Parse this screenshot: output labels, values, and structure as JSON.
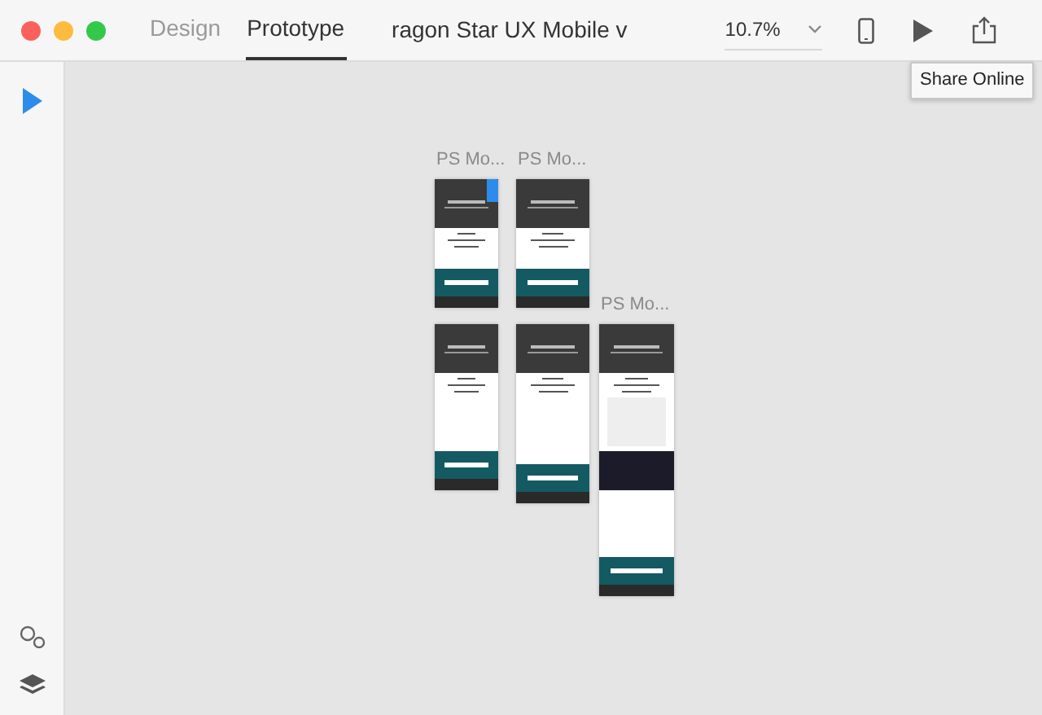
{
  "tabs": [
    {
      "label": "Design",
      "selected": false
    },
    {
      "label": "Prototype",
      "selected": true
    }
  ],
  "document_title": "ragon Star UX Mobile v",
  "zoom": "10.7%",
  "tooltip": "Share Online",
  "artboards": [
    {
      "label": "PS Mo...",
      "home": true
    },
    {
      "label": "PS Mo...",
      "home": false
    },
    {
      "home": false
    },
    {
      "home": false
    },
    {
      "label": "PS Mo...",
      "home": false
    }
  ]
}
